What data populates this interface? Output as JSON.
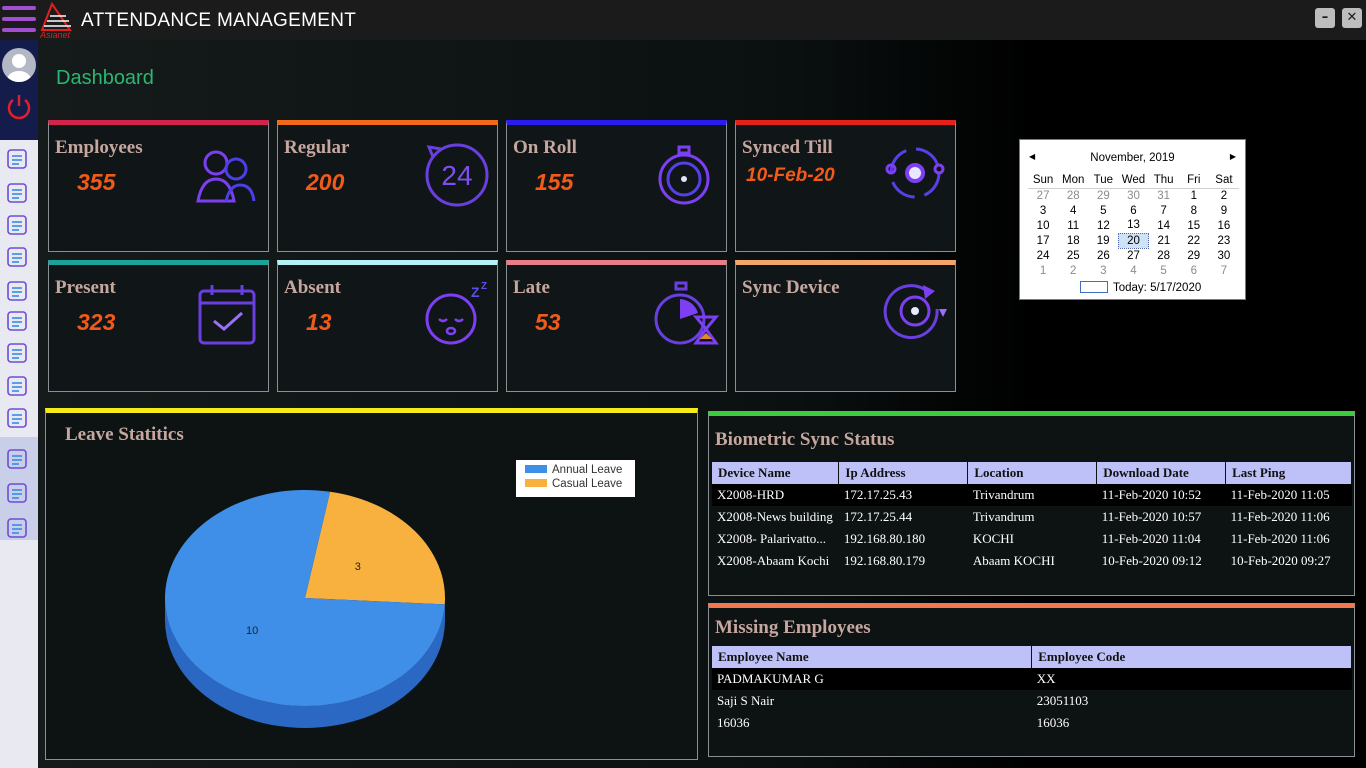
{
  "app": {
    "title": "ATTENDANCE MANAGEMENT",
    "logo_text": "Asianet",
    "minimize": "–",
    "close": "✕"
  },
  "page_title": "Dashboard",
  "sidebar": {
    "icons": [
      "report-icon",
      "globe-icon",
      "building-icon",
      "briefcase-icon",
      "umbrella-icon",
      "calendar-icon",
      "stopwatch-icon",
      "checklist-icon",
      "user-search-icon",
      "document-icon",
      "id-card-icon",
      "settings-icon"
    ]
  },
  "cards": [
    {
      "label": "Employees",
      "value": "355",
      "accent": "#d2234a",
      "icon": "employees-icon"
    },
    {
      "label": "Regular",
      "value": "200",
      "accent": "#f06a1a",
      "icon": "clock-24-icon"
    },
    {
      "label": "On Roll",
      "value": "155",
      "accent": "#2a1cf0",
      "icon": "stopwatch-icon"
    },
    {
      "label": "Synced Till",
      "value": "10-Feb-20",
      "accent": "#e3201a",
      "icon": "sync-icon"
    },
    {
      "label": "Present",
      "value": "323",
      "accent": "#1aa39a",
      "icon": "calendar-check-icon"
    },
    {
      "label": "Absent",
      "value": "13",
      "accent": "#b4f0f4",
      "icon": "sleeping-face-icon"
    },
    {
      "label": "Late",
      "value": "53",
      "accent": "#e97c86",
      "icon": "hourglass-timer-icon"
    },
    {
      "label": "Sync Device",
      "value": "",
      "accent": "#f3a66a",
      "icon": "sync-device-icon"
    }
  ],
  "calendar": {
    "month_label": "November, 2019",
    "weekdays": [
      "Sun",
      "Mon",
      "Tue",
      "Wed",
      "Thu",
      "Fri",
      "Sat"
    ],
    "weeks": [
      [
        "27",
        "28",
        "29",
        "30",
        "31",
        "1",
        "2"
      ],
      [
        "3",
        "4",
        "5",
        "6",
        "7",
        "8",
        "9"
      ],
      [
        "10",
        "11",
        "12",
        "13",
        "14",
        "15",
        "16"
      ],
      [
        "17",
        "18",
        "19",
        "20",
        "21",
        "22",
        "23"
      ],
      [
        "24",
        "25",
        "26",
        "27",
        "28",
        "29",
        "30"
      ],
      [
        "1",
        "2",
        "3",
        "4",
        "5",
        "6",
        "7"
      ]
    ],
    "selected": "20",
    "today_label": "Today: 5/17/2020"
  },
  "leave": {
    "title": "Leave Statitics",
    "legend": [
      {
        "name": "Annual Leave",
        "color": "#3f8fe8"
      },
      {
        "name": "Casual Leave",
        "color": "#f8b13f"
      }
    ]
  },
  "chart_data": {
    "type": "pie",
    "title": "Leave Statitics",
    "categories": [
      "Annual Leave",
      "Casual Leave"
    ],
    "values": [
      10,
      3
    ],
    "colors": [
      "#3f8fe8",
      "#f8b13f"
    ],
    "legend_position": "top-right"
  },
  "sync": {
    "title": "Biometric  Sync Status",
    "columns": [
      "Device Name",
      "Ip Address",
      "Location",
      "Download Date",
      "Last Ping"
    ],
    "rows": [
      [
        "X2008-HRD",
        "172.17.25.43",
        "Trivandrum",
        "11-Feb-2020 10:52",
        "11-Feb-2020 11:05"
      ],
      [
        "X2008-News building",
        "172.17.25.44",
        "Trivandrum",
        "11-Feb-2020 10:57",
        "11-Feb-2020 11:06"
      ],
      [
        "X2008- Palarivatto...",
        "192.168.80.180",
        "KOCHI",
        "11-Feb-2020 11:04",
        "11-Feb-2020 11:06"
      ],
      [
        "X2008-Abaam Kochi",
        "192.168.80.179",
        "Abaam KOCHI",
        "10-Feb-2020 09:12",
        "10-Feb-2020 09:27"
      ]
    ]
  },
  "missing": {
    "title": "Missing Employees",
    "columns": [
      "Employee Name",
      "Employee Code"
    ],
    "rows": [
      [
        "PADMAKUMAR G",
        "XX"
      ],
      [
        "Saji S Nair",
        "23051103"
      ],
      [
        "16036",
        "16036"
      ]
    ]
  },
  "colors": {
    "leave_panel_accent": "#f5ec15",
    "sync_panel_accent": "#3dcc3d",
    "missing_panel_accent": "#f2794f",
    "card_value": "#f25a19",
    "dashboard_title": "#2bb673"
  }
}
